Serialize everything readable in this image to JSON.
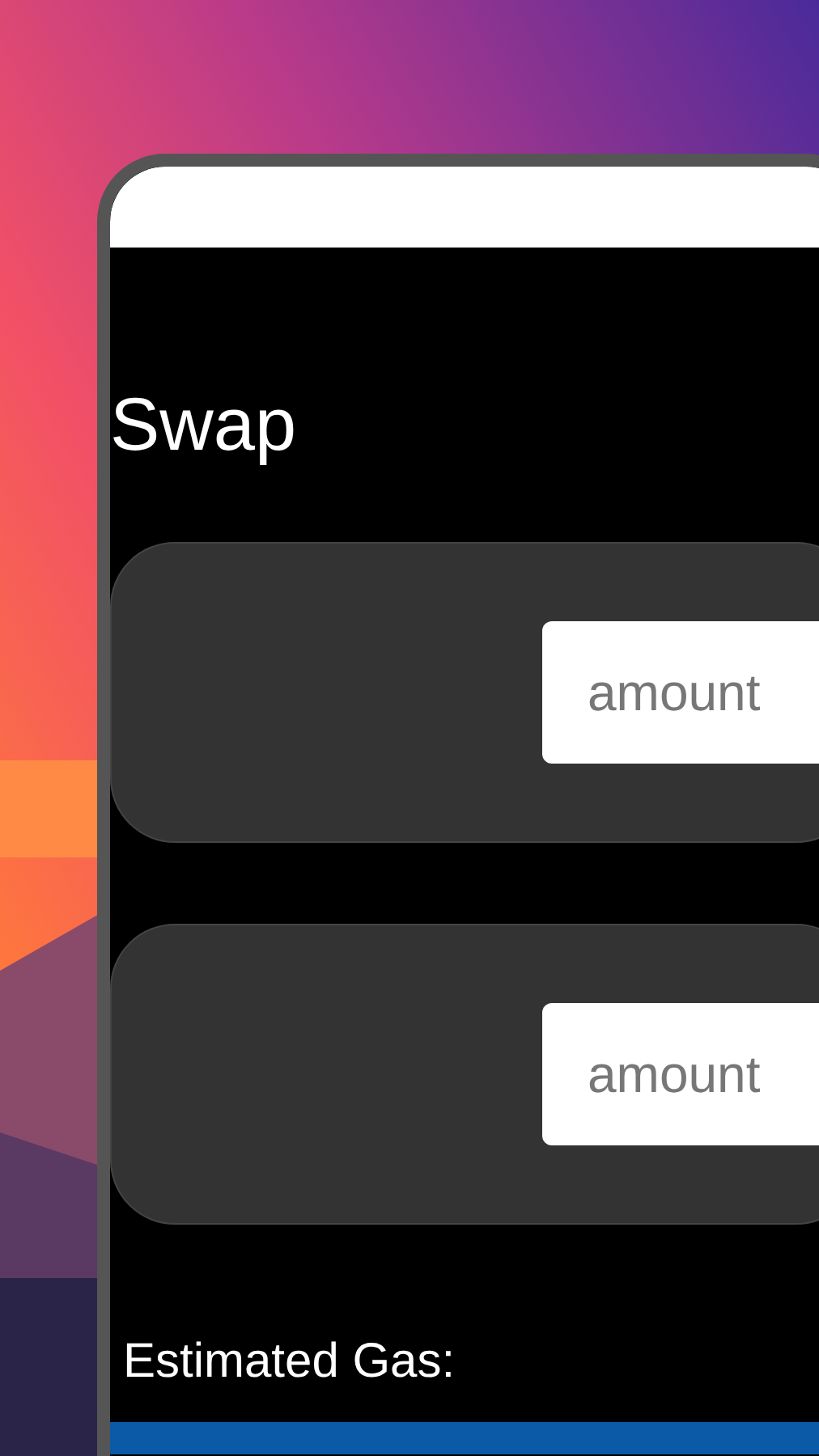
{
  "screen": {
    "title": "Swap",
    "inputs": [
      {
        "placeholder": "amount"
      },
      {
        "placeholder": "amount"
      }
    ],
    "gas_label": "Estimated Gas:"
  }
}
